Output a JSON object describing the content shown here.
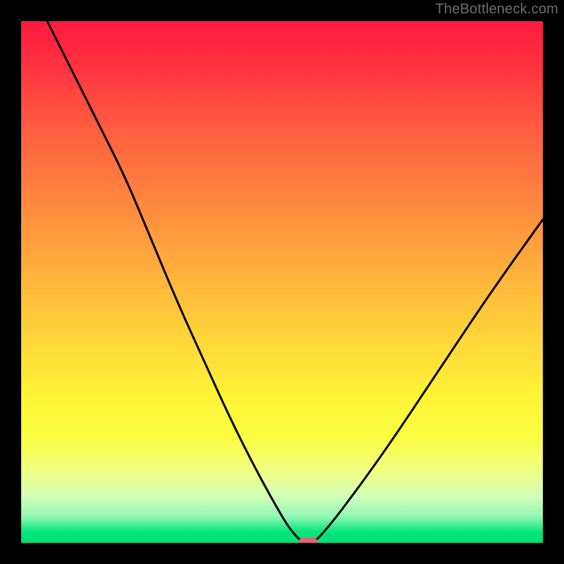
{
  "watermark": "TheBottleneck.com",
  "chart_data": {
    "type": "line",
    "title": "",
    "xlabel": "",
    "ylabel": "",
    "xlim": [
      0,
      100
    ],
    "ylim": [
      0,
      100
    ],
    "grid": false,
    "legend": false,
    "series": [
      {
        "name": "bottleneck-curve",
        "x": [
          5,
          10,
          15,
          20,
          25,
          30,
          35,
          40,
          45,
          50,
          52,
          54,
          56,
          58,
          62,
          70,
          80,
          90,
          100
        ],
        "y": [
          100,
          90,
          80,
          70,
          58,
          46,
          35,
          24,
          14,
          5,
          2,
          0,
          0,
          2,
          7,
          18,
          33,
          48,
          62
        ]
      }
    ],
    "marker": {
      "x": 55,
      "y": 0,
      "color": "#e06670"
    },
    "background": {
      "type": "vertical-gradient",
      "stops": [
        {
          "pos": 0,
          "color": "#ff1a3f"
        },
        {
          "pos": 20,
          "color": "#ff5b40"
        },
        {
          "pos": 48,
          "color": "#ffb03c"
        },
        {
          "pos": 72,
          "color": "#fff336"
        },
        {
          "pos": 95,
          "color": "#8ff7b3"
        },
        {
          "pos": 100,
          "color": "#00e07a"
        }
      ]
    }
  }
}
